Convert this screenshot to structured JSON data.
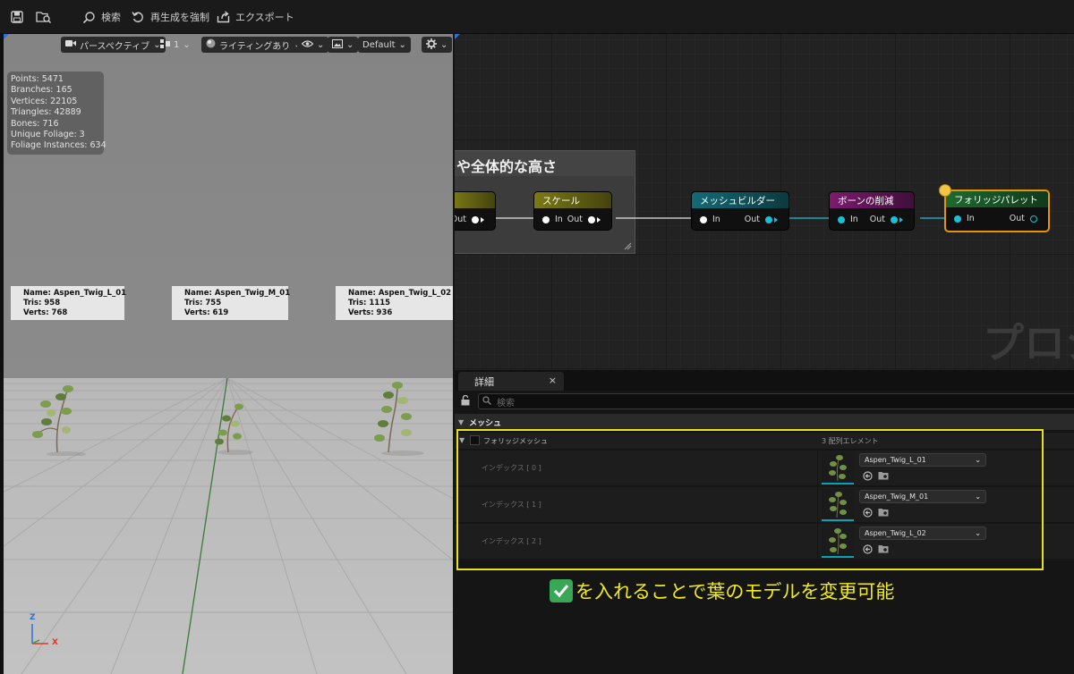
{
  "toolbar": {
    "search_label": "検索",
    "regenerate_label": "再生成を強制",
    "export_label": "エクスポート"
  },
  "viewport": {
    "perspective_label": "パースペクティブ",
    "layout_label": "1",
    "lighting_label": "ライティングあり",
    "view_mode_label": "Default",
    "stats": [
      "Points: 5471",
      "Branches: 165",
      "Vertices: 22105",
      "Triangles: 42889",
      "Bones: 716",
      "Unique Foliage: 3",
      "Foliage Instances: 634"
    ],
    "mesh_labels": [
      {
        "name": "Name: Aspen_Twig_L_01",
        "tris": "Tris: 958",
        "verts": "Verts: 768"
      },
      {
        "name": "Name: Aspen_Twig_M_01",
        "tris": "Tris: 755",
        "verts": "Verts: 619"
      },
      {
        "name": "Name: Aspen_Twig_L_02",
        "tris": "Tris: 1115",
        "verts": "Verts: 936"
      }
    ],
    "axis_z": "Z",
    "axis_x": "X"
  },
  "graph": {
    "comment_title": "や全体的な高さ",
    "watermark": "プロシ",
    "nodes": [
      {
        "title": "",
        "in": "",
        "out": "Out",
        "color": "#7c7a14"
      },
      {
        "title": "スケール",
        "in": "In",
        "out": "Out",
        "color": "#7c7a14"
      },
      {
        "title": "メッシュビルダー",
        "in": "In",
        "out": "Out",
        "color": "#136a76"
      },
      {
        "title": "ボーンの削減",
        "in": "In",
        "out": "Out",
        "color": "#7d1a70"
      },
      {
        "title": "フォリッジパレット",
        "in": "In",
        "out": "Out",
        "color": "#1d6a2e"
      }
    ],
    "wire_color_white": "#e6e6e6",
    "wire_color_cyan": "#17c2d6",
    "selected_border": "#e9920c"
  },
  "details": {
    "tab_label": "詳細",
    "search_placeholder": "検索",
    "category": "メッシュ",
    "property_name": "フォリッジメッシュ",
    "array_count": "3 配列エレメント",
    "rows": [
      {
        "index": "インデックス [ 0 ]",
        "mesh": "Aspen_Twig_L_01"
      },
      {
        "index": "インデックス [ 1 ]",
        "mesh": "Aspen_Twig_M_01"
      },
      {
        "index": "インデックス [ 2 ]",
        "mesh": "Aspen_Twig_L_02"
      }
    ]
  },
  "annotation": {
    "caption": "を入れることで葉のモデルを変更可能",
    "highlight_color": "#e7e21a"
  }
}
